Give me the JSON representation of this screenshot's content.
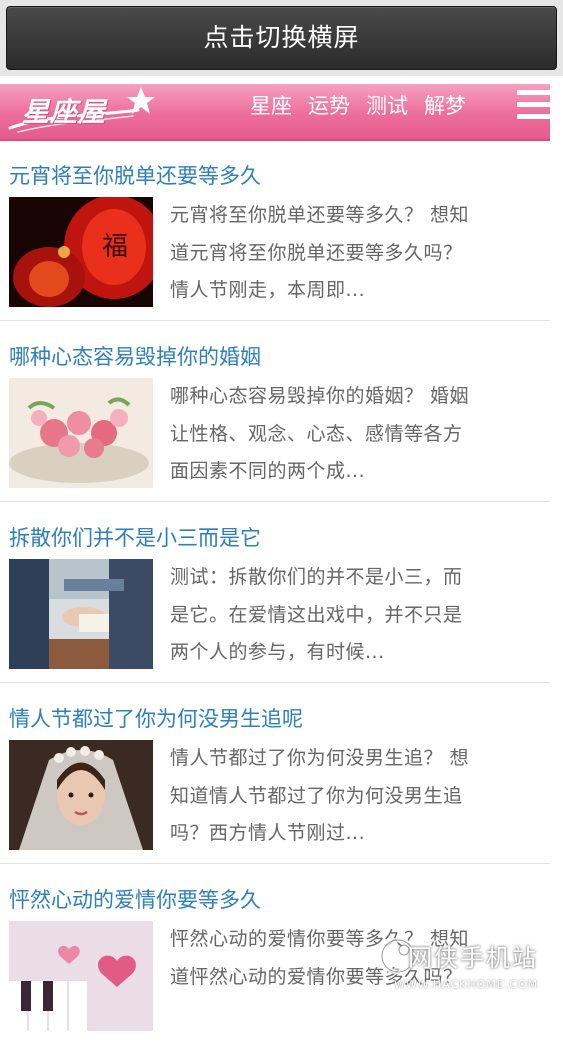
{
  "rotate_button": {
    "label": "点击切换横屏"
  },
  "header": {
    "logo_text": "星座屋",
    "nav": [
      {
        "label": "星座"
      },
      {
        "label": "运势"
      },
      {
        "label": "测试"
      },
      {
        "label": "解梦"
      }
    ],
    "menu_icon": "hamburger-menu-icon",
    "colors": {
      "header_pink": "#ec6e9b",
      "title_blue": "#2d7fbd",
      "excerpt_gray": "#666666"
    }
  },
  "articles": [
    {
      "title": "元宵将至你脱单还要等多久",
      "excerpt_lines": [
        "元宵将至你脱单还要等多久？ 想知",
        "道元宵将至你脱单还要等多久吗？",
        "情人节刚走，本周即..."
      ],
      "thumb": "red-lanterns-image"
    },
    {
      "title": "哪种心态容易毁掉你的婚姻",
      "excerpt_lines": [
        "哪种心态容易毁掉你的婚姻？ 婚姻",
        "让性格、观念、心态、感情等各方",
        "面因素不同的两个成..."
      ],
      "thumb": "pink-roses-image"
    },
    {
      "title": "拆散你们并不是小三而是它",
      "excerpt_lines": [
        "测试：拆散你们的并不是小三，而",
        "是它。在爱情这出戏中，并不只是",
        "两个人的参与，有时候..."
      ],
      "thumb": "couple-hands-image"
    },
    {
      "title": "情人节都过了你为何没男生追呢",
      "excerpt_lines": [
        "情人节都过了你为何没男生追？ 想",
        "知道情人节都过了你为何没男生追",
        "吗？西方情人节刚过..."
      ],
      "thumb": "bride-veil-image"
    },
    {
      "title": "怦然心动的爱情你要等多久",
      "excerpt_lines": [
        "怦然心动的爱情你要等多久？ 想知",
        "道怦然心动的爱情你要等多久吗？",
        ""
      ],
      "thumb": "piano-hearts-image"
    }
  ],
  "watermark": {
    "main": "网侠手机站",
    "sub": "WWW.HACKHOME.COM"
  }
}
